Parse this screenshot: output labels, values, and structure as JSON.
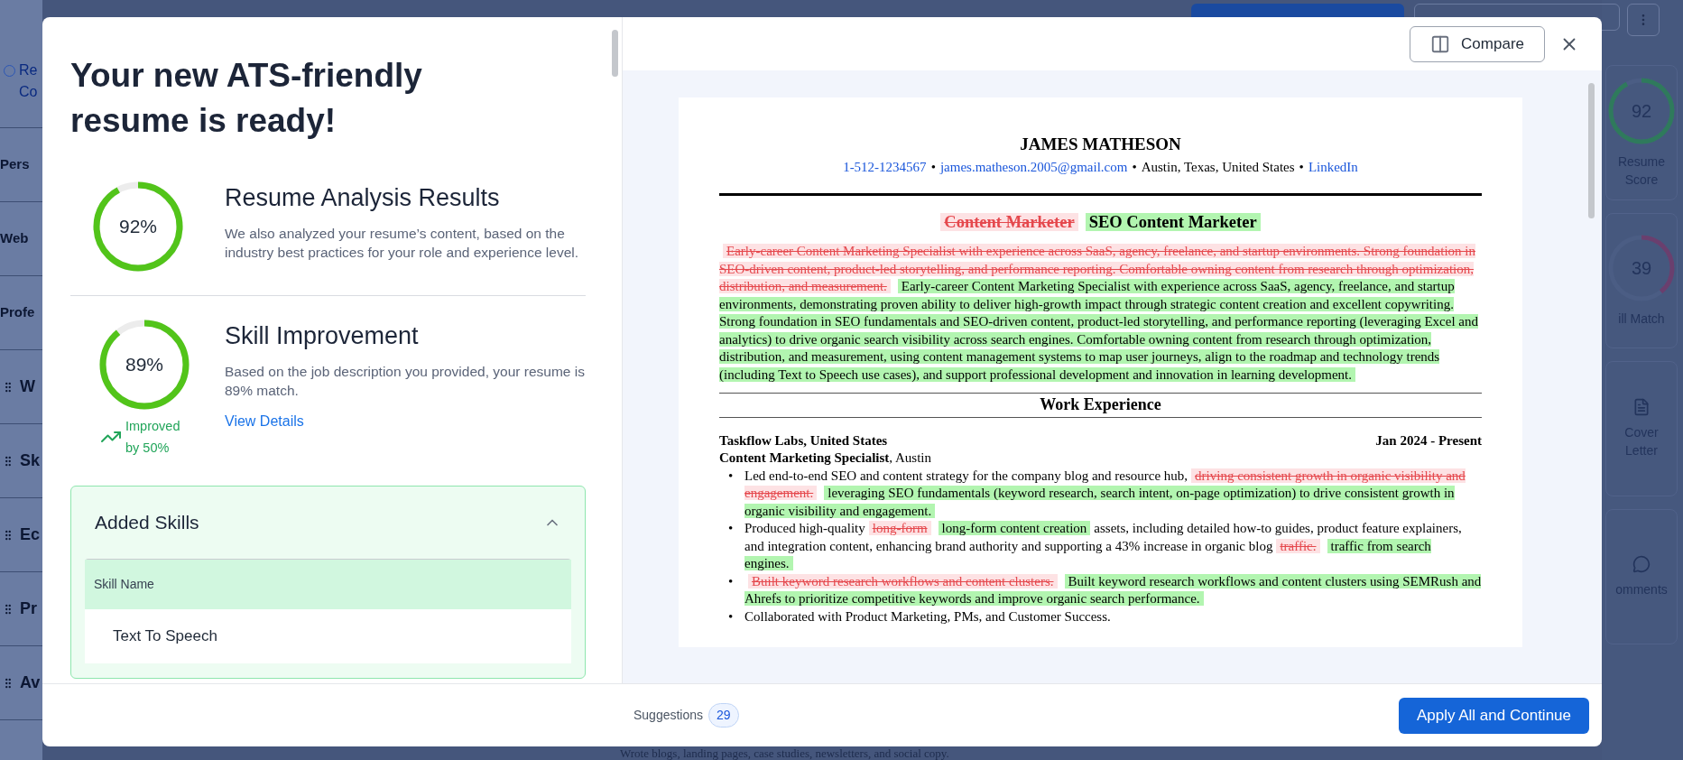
{
  "background": {
    "left_items": [
      {
        "text": "Re\nCo",
        "kind": "link"
      },
      {
        "text": "Pers",
        "kind": "plain"
      },
      {
        "text": "Web",
        "kind": "plain"
      },
      {
        "text": "Profe",
        "kind": "plain"
      },
      {
        "text": "W",
        "kind": "drag"
      },
      {
        "text": "Sk",
        "kind": "drag"
      },
      {
        "text": "Ec",
        "kind": "drag"
      },
      {
        "text": "Pr",
        "kind": "drag"
      },
      {
        "text": "Av",
        "kind": "drag"
      }
    ],
    "right_cards": [
      {
        "kind": "score",
        "value": "92",
        "label": "Resume\nScore",
        "level": 0.92,
        "color": "#2f7a5c"
      },
      {
        "kind": "score",
        "value": "39",
        "label": "ill Match",
        "level": 0.39,
        "color": "#6a3f6e"
      },
      {
        "kind": "document",
        "label": "Cover\nLetter"
      },
      {
        "kind": "comment",
        "label": "omments"
      }
    ],
    "bottom_text": "Wrote blogs, landing pages, case studies, newsletters, and social copy."
  },
  "modal": {
    "title": "Your new ATS-friendly resume is ready!",
    "analysis": {
      "score": "92%",
      "level": 0.92,
      "heading": "Resume Analysis Results",
      "text": "We also analyzed your resume’s content, based on the industry best practices for your role and experience level."
    },
    "skills": {
      "score": "89%",
      "level": 0.89,
      "heading": "Skill Improvement",
      "text": "Based on the job description you provided, your resume is 89% match.",
      "link": "View Details",
      "improved": "Improved by 50%"
    },
    "added_skills": {
      "heading": "Added Skills",
      "expanded": true,
      "column": "Skill Name",
      "rows": [
        "Text To Speech"
      ]
    },
    "compare_button": "Compare",
    "resume": {
      "name": "JAMES MATHESON",
      "contacts": [
        {
          "text": "1-512-1234567",
          "kind": "link"
        },
        {
          "text": "•",
          "kind": "plain"
        },
        {
          "text": "james.matheson.2005@gmail.com",
          "kind": "link"
        },
        {
          "text": "•",
          "kind": "plain"
        },
        {
          "text": "Austin, Texas, United States",
          "kind": "plain"
        },
        {
          "text": "•",
          "kind": "plain"
        },
        {
          "text": "LinkedIn",
          "kind": "link"
        }
      ],
      "title": [
        {
          "text": "Content Marketer",
          "kind": "removed"
        },
        {
          "text": "SEO Content Marketer",
          "kind": "added"
        }
      ],
      "summary": [
        {
          "text": "Early-career Content Marketing Specialist with experience across SaaS, agency, freelance, and startup environments. Strong foundation in SEO-driven content, product-led storytelling, and performance reporting. Comfortable owning content from research through optimization, distribution, and measurement.",
          "kind": "removed"
        },
        {
          "text": "Early-career Content Marketing Specialist with experience across SaaS, agency, freelance, and startup environments, demonstrating proven ability to deliver high-growth impact through strategic content creation and excellent copywriting. Strong foundation in SEO fundamentals and SEO-driven content, product-led storytelling, and performance reporting (leveraging Excel and analytics) to drive organic search visibility across search engines. Comfortable owning content from research through optimization, distribution, and measurement, using content management systems to map user journeys, align to the roadmap and technology trends (including Text to Speech use cases), and support professional development and innovation in learning development.",
          "kind": "added"
        }
      ],
      "section": "Work Experience",
      "bullet_marker": "•",
      "job": {
        "company": "Taskflow Labs, United States",
        "date": "Jan 2024 - Present",
        "role": "**Content Marketing Specialist**, Austin",
        "bullets": [
          [
            {
              "text": "Led end-to-end SEO and content strategy for the company blog and resource hub,",
              "kind": "plain"
            },
            {
              "text": "driving consistent growth in organic visibility and engagement.",
              "kind": "removed"
            },
            {
              "text": "leveraging SEO fundamentals (keyword research, search intent, on-page optimization) to drive consistent growth in organic visibility and engagement.",
              "kind": "added"
            }
          ],
          [
            {
              "text": "Produced high-quality",
              "kind": "plain"
            },
            {
              "text": "long-form",
              "kind": "removed"
            },
            {
              "text": "long-form content creation",
              "kind": "added"
            },
            {
              "text": "assets, including detailed how-to guides, product feature explainers, and integration content, enhancing brand authority and supporting a 43% increase in organic blog",
              "kind": "plain"
            },
            {
              "text": "traffic.",
              "kind": "removed"
            },
            {
              "text": "traffic from search engines.",
              "kind": "added"
            }
          ],
          [
            {
              "text": "Built keyword research workflows and content clusters.",
              "kind": "removed"
            },
            {
              "text": "Built keyword research workflows and content clusters using SEMRush and Ahrefs to prioritize competitive keywords and improve organic search performance.",
              "kind": "added"
            }
          ],
          [
            {
              "text": "Collaborated with Product Marketing, PMs, and Customer Success.",
              "kind": "plain"
            }
          ]
        ]
      }
    },
    "suggestions_label": "Suggestions",
    "suggestions_count": "29",
    "apply_button": "Apply All and Continue"
  }
}
